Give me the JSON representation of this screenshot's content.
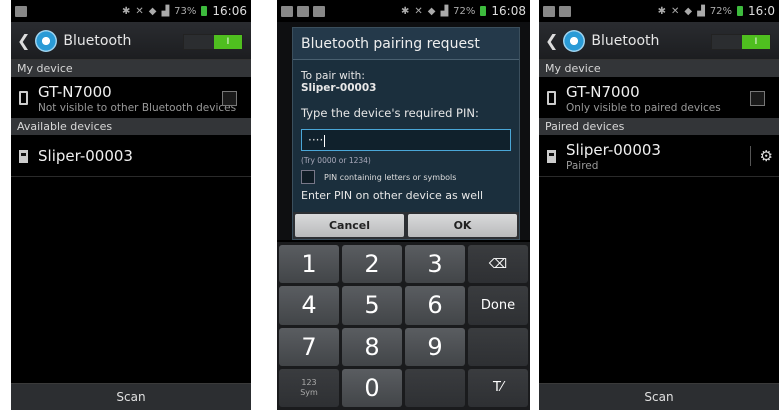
{
  "screen1": {
    "status_time": "16:06",
    "status_battery": "73%",
    "title": "Bluetooth",
    "toggle_label": "I",
    "section_my_device": "My device",
    "device_name": "GT-N7000",
    "device_sub": "Not visible to other Bluetooth devices",
    "section_available": "Available devices",
    "available_device": "Sliper-00003",
    "scan_label": "Scan"
  },
  "screen2": {
    "status_time": "16:08",
    "status_battery": "72%",
    "dialog_title": "Bluetooth pairing request",
    "pair_with": "To pair with:",
    "pair_device": "Sliper-00003",
    "prompt": "Type the device's required PIN:",
    "pin_value": "····",
    "hint": "(Try 0000 or 1234)",
    "check_label": "PIN containing letters or symbols",
    "enter_pin": "Enter PIN on other device as well",
    "cancel_label": "Cancel",
    "ok_label": "OK",
    "keys": [
      "1",
      "2",
      "3",
      "⌫",
      "4",
      "5",
      "6",
      "Done",
      "7",
      "8",
      "9",
      "",
      "123\nSym",
      "0",
      "",
      "T⁄"
    ]
  },
  "screen3": {
    "status_time": "16:0",
    "status_battery": "72%",
    "title": "Bluetooth",
    "toggle_label": "I",
    "section_my_device": "My device",
    "device_name": "GT-N7000",
    "device_sub": "Only visible to paired devices",
    "section_paired": "Paired devices",
    "paired_device": "Sliper-00003",
    "paired_sub": "Paired",
    "scan_label": "Scan"
  },
  "icons": {
    "gear": "⚙",
    "back": "‹",
    "backspace": "⌫"
  },
  "colors": {
    "toggle_on": "#4fbf1f",
    "dialog_bg": "#1b2f3d",
    "input_border": "#4aa7d8"
  }
}
